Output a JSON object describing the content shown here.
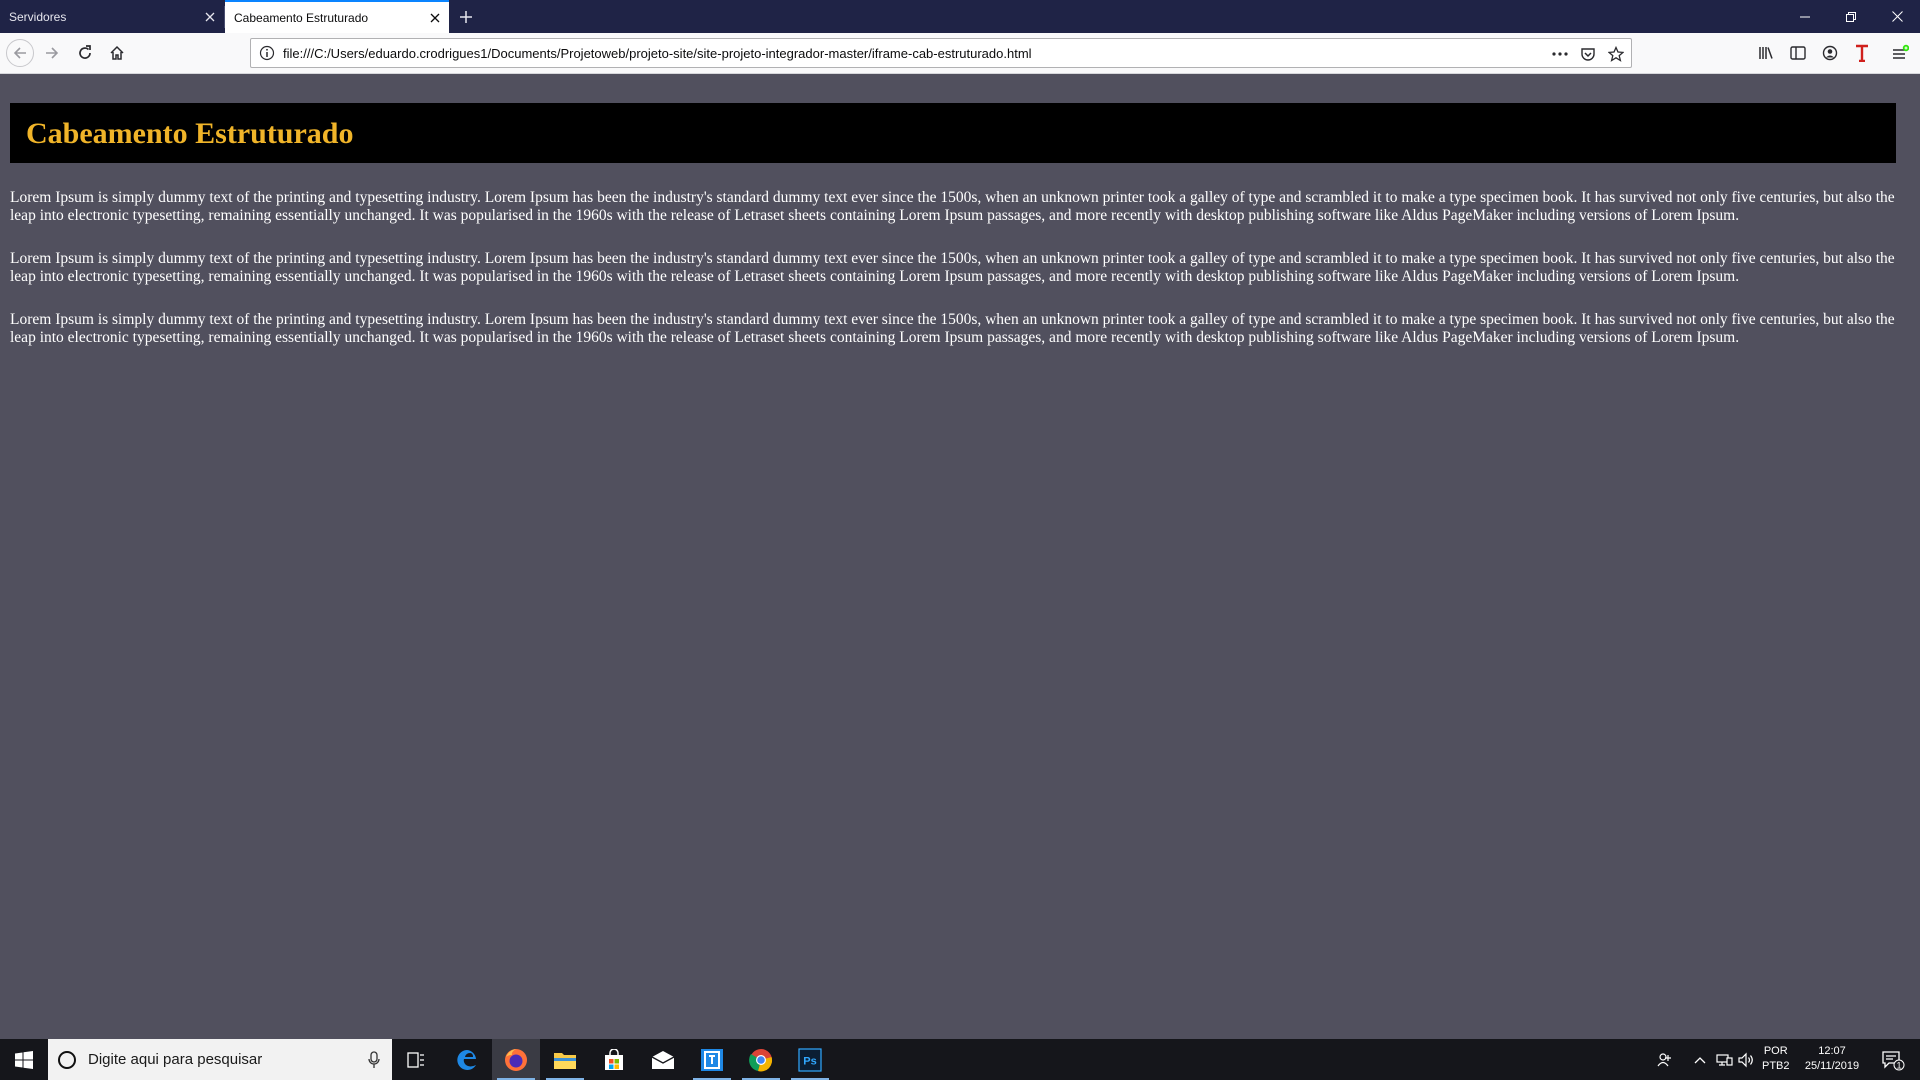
{
  "browser": {
    "tabs": [
      {
        "title": "Servidores",
        "active": false
      },
      {
        "title": "Cabeamento Estruturado",
        "active": true
      }
    ],
    "url": "file:///C:/Users/eduardo.crodrigues1/Documents/Projetoweb/projeto-site/site-projeto-integrador-master/iframe-cab-estruturado.html",
    "icons": [
      "back-icon",
      "forward-icon",
      "reload-icon",
      "home-icon",
      "info-icon",
      "more-icon",
      "pocket-icon",
      "bookmark-star-icon",
      "library-icon",
      "sidebar-icon",
      "account-icon",
      "extension-t-icon",
      "menu-icon"
    ]
  },
  "page": {
    "title": "Cabeamento Estruturado",
    "paragraphs": [
      "Lorem Ipsum is simply dummy text of the printing and typesetting industry. Lorem Ipsum has been the industry's standard dummy text ever since the 1500s, when an unknown printer took a galley of type and scrambled it to make a type specimen book. It has survived not only five centuries, but also the leap into electronic typesetting, remaining essentially unchanged. It was popularised in the 1960s with the release of Letraset sheets containing Lorem Ipsum passages, and more recently with desktop publishing software like Aldus PageMaker including versions of Lorem Ipsum.",
      "Lorem Ipsum is simply dummy text of the printing and typesetting industry. Lorem Ipsum has been the industry's standard dummy text ever since the 1500s, when an unknown printer took a galley of type and scrambled it to make a type specimen book. It has survived not only five centuries, but also the leap into electronic typesetting, remaining essentially unchanged. It was popularised in the 1960s with the release of Letraset sheets containing Lorem Ipsum passages, and more recently with desktop publishing software like Aldus PageMaker including versions of Lorem Ipsum.",
      "Lorem Ipsum is simply dummy text of the printing and typesetting industry. Lorem Ipsum has been the industry's standard dummy text ever since the 1500s, when an unknown printer took a galley of type and scrambled it to make a type specimen book. It has survived not only five centuries, but also the leap into electronic typesetting, remaining essentially unchanged. It was popularised in the 1960s with the release of Letraset sheets containing Lorem Ipsum passages, and more recently with desktop publishing software like Aldus PageMaker including versions of Lorem Ipsum."
    ],
    "colors": {
      "background": "#51505e",
      "header_bg": "#000000",
      "title": "#f0b429",
      "text": "#ffffff"
    }
  },
  "taskbar": {
    "search_placeholder": "Digite aqui para pesquisar",
    "apps": [
      "task-view-icon",
      "edge-icon",
      "firefox-icon",
      "file-explorer-icon",
      "store-icon",
      "mail-icon",
      "app-icon",
      "chrome-icon",
      "photoshop-icon"
    ],
    "photoshop_label": "Ps",
    "language": "POR",
    "keyboard": "PTB2",
    "time": "12:07",
    "date": "25/11/2019",
    "notification_count": "1"
  }
}
